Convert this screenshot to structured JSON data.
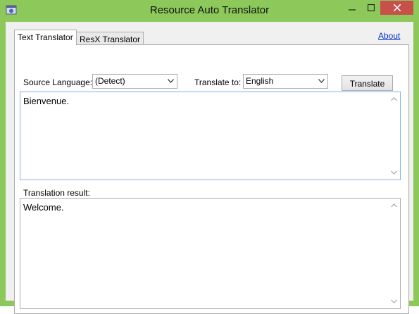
{
  "window": {
    "title": "Resource Auto Translator"
  },
  "tabs": [
    {
      "label": "Text Translator",
      "active": true
    },
    {
      "label": "ResX Translator",
      "active": false
    }
  ],
  "about_label": "About",
  "source": {
    "label": "Source Language:",
    "value": "(Detect)"
  },
  "target": {
    "label": "Translate to:",
    "value": "English"
  },
  "translate_label": "Translate",
  "source_text": "Bienvenue.",
  "result_label": "Translation result:",
  "result_text": "Welcome.",
  "colors": {
    "titlebar": "#8cc85a",
    "close": "#c7504a",
    "link": "#0033cc",
    "focus_border": "#7eb4ea"
  },
  "icons": [
    "app-icon",
    "minimize-icon",
    "maximize-icon",
    "close-icon",
    "chevron-down-icon",
    "scroll-up-icon",
    "scroll-down-icon"
  ]
}
